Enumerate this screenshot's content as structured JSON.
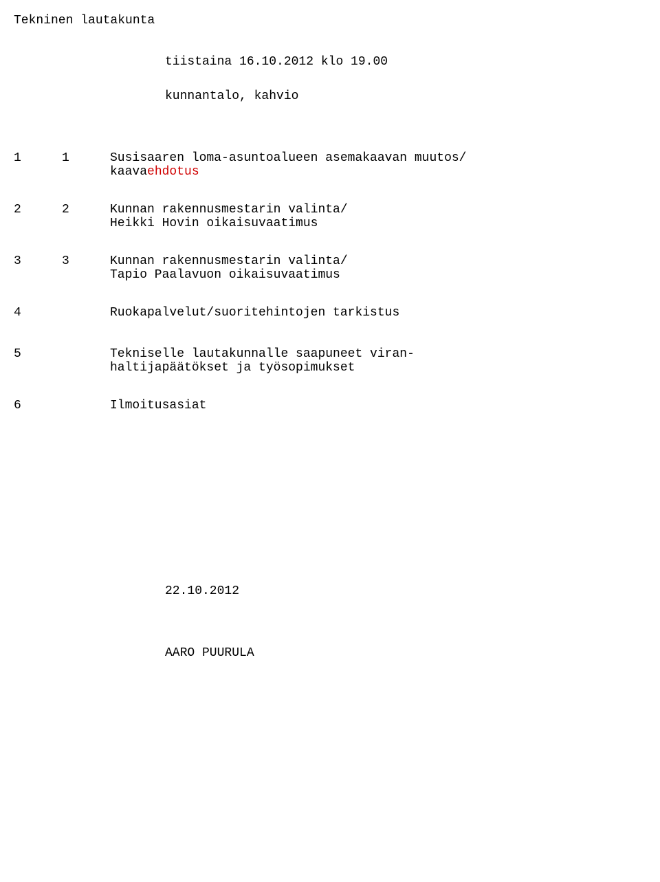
{
  "title": "Tekninen lautakunta",
  "meeting": {
    "time": "tiistaina 16.10.2012 klo 19.00",
    "place": "kunnantalo, kahvio"
  },
  "agenda": [
    {
      "num_left": "1",
      "num_right": "1",
      "line1_pre": "Susisaaren loma-asuntoalueen asemakaavan muutos/",
      "line2_pre": "kaava",
      "line2_red": "ehdotus"
    },
    {
      "num_left": "2",
      "num_right": "2",
      "line1": "Kunnan rakennusmestarin valinta/",
      "line2": "Heikki Hovin oikaisuvaatimus"
    },
    {
      "num_left": "3",
      "num_right": "3",
      "line1": "Kunnan rakennusmestarin valinta/",
      "line2": "Tapio Paalavuon oikaisuvaatimus"
    },
    {
      "num_left": "4",
      "num_right": "",
      "line1": "Ruokapalvelut/suoritehintojen tarkistus"
    },
    {
      "num_left": "5",
      "num_right": "",
      "line1": "Tekniselle lautakunnalle saapuneet viran-",
      "line2": "haltijapäätökset ja työsopimukset"
    },
    {
      "num_left": "6",
      "num_right": "",
      "line1": "Ilmoitusasiat"
    }
  ],
  "date": "22.10.2012",
  "signer": "AARO PUURULA"
}
